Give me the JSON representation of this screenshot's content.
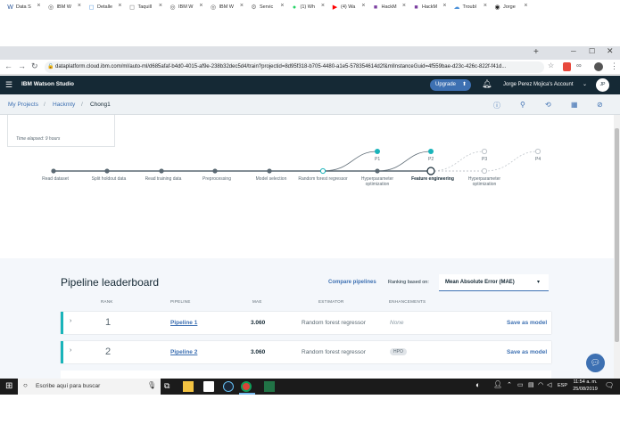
{
  "browser": {
    "tabs": [
      {
        "label": "Data S",
        "color": "#2b579a",
        "glyph": "W",
        "active": false
      },
      {
        "label": "IBM W",
        "color": "#555555",
        "glyph": "◎",
        "active": false
      },
      {
        "label": "Detalle",
        "color": "#4a90d9",
        "glyph": "◻",
        "active": false
      },
      {
        "label": "Taquill",
        "color": "#666666",
        "glyph": "◻",
        "active": false
      },
      {
        "label": "IBM W",
        "color": "#555555",
        "glyph": "◎",
        "active": true
      },
      {
        "label": "IBM W",
        "color": "#555555",
        "glyph": "◎",
        "active": false
      },
      {
        "label": "Servic",
        "color": "#777777",
        "glyph": "⚙",
        "active": false
      },
      {
        "label": "(1) Wh",
        "color": "#25d366",
        "glyph": "●",
        "active": false
      },
      {
        "label": "(4) Wa",
        "color": "#ff0000",
        "glyph": "▶",
        "active": false
      },
      {
        "label": "HackM",
        "color": "#7b3fa0",
        "glyph": "■",
        "active": false
      },
      {
        "label": "HackM",
        "color": "#7b3fa0",
        "glyph": "■",
        "active": false
      },
      {
        "label": "Troubl",
        "color": "#4a90d9",
        "glyph": "☁",
        "active": false
      },
      {
        "label": "Jorge",
        "color": "#222222",
        "glyph": "◉",
        "active": false
      }
    ],
    "new_tab": "+",
    "url": "dataplatform.cloud.ibm.com/ml/auto-ml/d685afaf-b4d0-4015-af9e-238b32dec5d4/train?projectid=8d95f318-b705-4480-a1e5-578354614d2f&mlInstanceGuid=4f559bae-d23c-426c-822f-f41d..."
  },
  "app": {
    "brand": "IBM Watson Studio",
    "upgrade_label": "Upgrade",
    "account_label": "Jorge Perez Mojica's Account",
    "avatar_initials": "JP"
  },
  "breadcrumb": {
    "items": [
      "My Projects",
      "Hackmty",
      "Chong1"
    ]
  },
  "experiment": {
    "time_elapsed": "Time elapsed: 9 hours",
    "steps": [
      "Read dataset",
      "Split holdout data",
      "Read training data",
      "Preprocessing",
      "Model selection",
      "Random forest regressor",
      "Hyperparameter optimization",
      "Feature engineering",
      "Hyperparameter optimization"
    ],
    "pipelines": [
      "P1",
      "P2",
      "P3",
      "P4"
    ]
  },
  "leaderboard": {
    "title": "Pipeline leaderboard",
    "compare_label": "Compare pipelines",
    "ranking_label": "Ranking based on:",
    "ranking_value": "Mean Absolute Error (MAE)",
    "columns": [
      "RANK",
      "PIPELINE",
      "MAE",
      "ESTIMATOR",
      "ENHANCEMENTS"
    ],
    "rows": [
      {
        "rank": "1",
        "pipeline": "Pipeline 1",
        "mae": "3.060",
        "estimator": "Random forest regressor",
        "enhancements": "None",
        "action": "Save as model"
      },
      {
        "rank": "2",
        "pipeline": "Pipeline 2",
        "mae": "3.060",
        "estimator": "Random forest regressor",
        "enhancements": "HPO",
        "action": "Save as model"
      }
    ]
  },
  "taskbar": {
    "search_placeholder": "Escribe aquí para buscar",
    "time": "11:54 a. m.",
    "date": "25/08/2019",
    "lang": "ESP"
  },
  "colors": {
    "accent": "#1ab4ba",
    "header": "#152935",
    "link": "#3d70b2",
    "upgrade": "#3d70b2"
  }
}
